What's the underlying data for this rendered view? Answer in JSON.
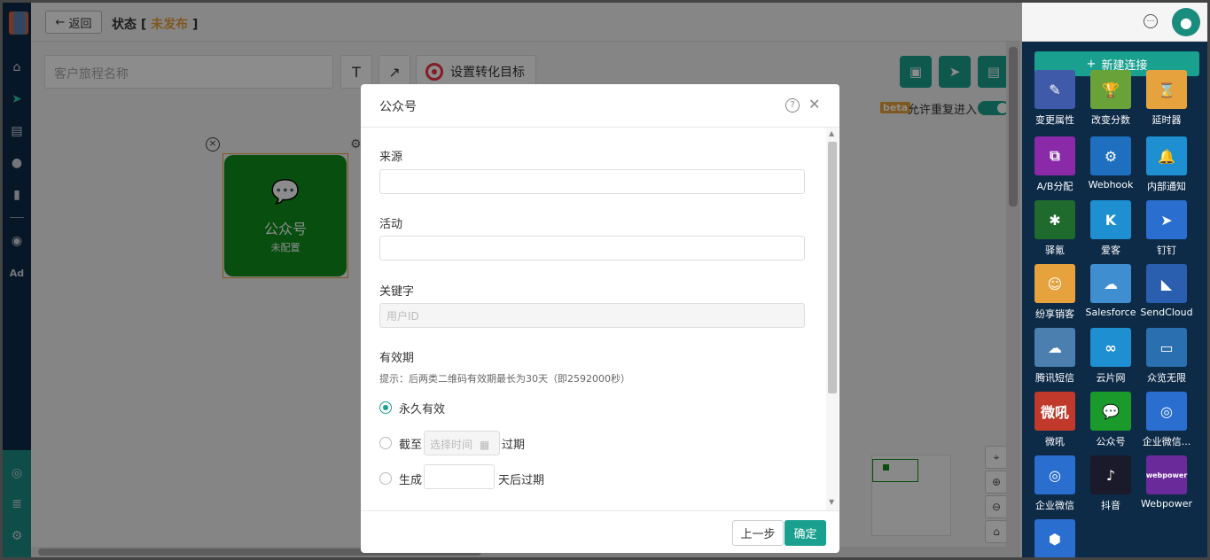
{
  "topbar": {
    "back_label": "返回",
    "status_label": "状态 [",
    "status_value": "未发布",
    "status_end": "]"
  },
  "canvas": {
    "name_placeholder": "客户旅程名称",
    "tool_text": "T",
    "tool_arrow": "↗",
    "goal_label": "设置转化目标",
    "beta": "beta",
    "allow_reentry": "允许重复进入",
    "node_title": "公众号",
    "node_sub": "未配置"
  },
  "right_panel": {
    "new_connection": "新建连接",
    "tiles": [
      {
        "label": "变更属性",
        "icon": "edit-icon",
        "glyph": "✎",
        "color": "#3f5aa8"
      },
      {
        "label": "改变分数",
        "icon": "trophy-icon",
        "glyph": "🏆",
        "color": "#6aa23a"
      },
      {
        "label": "延时器",
        "icon": "hourglass-icon",
        "glyph": "⌛",
        "color": "#e6a23c"
      },
      {
        "label": "A/B分配",
        "icon": "ab-split-icon",
        "glyph": "⧉",
        "color": "#8a2aa8"
      },
      {
        "label": "Webhook",
        "icon": "webhook-icon",
        "glyph": "⚙",
        "color": "#1e6fbf"
      },
      {
        "label": "内部通知",
        "icon": "bell-icon",
        "glyph": "🔔",
        "color": "#1e8fd0"
      },
      {
        "label": "驿氪",
        "icon": "spider-icon",
        "glyph": "✱",
        "color": "#1f6b2e"
      },
      {
        "label": "爱客",
        "icon": "aike-icon",
        "glyph": "K",
        "color": "#1e8fd0"
      },
      {
        "label": "钉钉",
        "icon": "dingtalk-icon",
        "glyph": "➤",
        "color": "#2a6fd0"
      },
      {
        "label": "纷享销客",
        "icon": "fxiaoke-icon",
        "glyph": "☺",
        "color": "#e6a23c"
      },
      {
        "label": "Salesforce",
        "icon": "salesforce-icon",
        "glyph": "☁",
        "color": "#3f8fd0"
      },
      {
        "label": "SendCloud",
        "icon": "sendcloud-icon",
        "glyph": "◣",
        "color": "#2a5fb0"
      },
      {
        "label": "腾讯短信",
        "icon": "tencent-sms-icon",
        "glyph": "☁",
        "color": "#4a7fb0"
      },
      {
        "label": "云片网",
        "icon": "yunpian-icon",
        "glyph": "∞",
        "color": "#1e8fd0"
      },
      {
        "label": "众览无限",
        "icon": "zhonglan-icon",
        "glyph": "▭",
        "color": "#2a6fb0"
      },
      {
        "label": "微吼",
        "icon": "vhall-icon",
        "glyph": "微吼",
        "color": "#c0392b"
      },
      {
        "label": "公众号",
        "icon": "wechat-icon",
        "glyph": "💬",
        "color": "#1a9a2a"
      },
      {
        "label": "企业微信...",
        "icon": "wecom-icon",
        "glyph": "◎",
        "color": "#2a6fd0"
      },
      {
        "label": "企业微信",
        "icon": "wecom-icon",
        "glyph": "◎",
        "color": "#2a6fd0"
      },
      {
        "label": "抖音",
        "icon": "douyin-icon",
        "glyph": "♪",
        "color": "#1a1a2a"
      },
      {
        "label": "Webpower",
        "icon": "webpower-icon",
        "glyph": "webpower",
        "color": "#6a2a9a"
      },
      {
        "label": "",
        "icon": "hexagon-icon",
        "glyph": "⬢",
        "color": "#2a6fd0"
      }
    ]
  },
  "modal": {
    "title": "公众号",
    "source_label": "来源",
    "source_value": "",
    "activity_label": "活动",
    "activity_value": "",
    "keyword_label": "关键字",
    "keyword_placeholder": "用户ID",
    "validity_label": "有效期",
    "validity_hint": "提示：后两类二维码有效期最长为30天（即2592000秒）",
    "opt_permanent": "永久有效",
    "opt_until_prefix": "截至",
    "opt_until_placeholder": "选择时间",
    "opt_until_suffix": "过期",
    "opt_days_prefix": "生成",
    "opt_days_suffix": "天后过期",
    "prev_label": "上一步",
    "ok_label": "确定"
  }
}
